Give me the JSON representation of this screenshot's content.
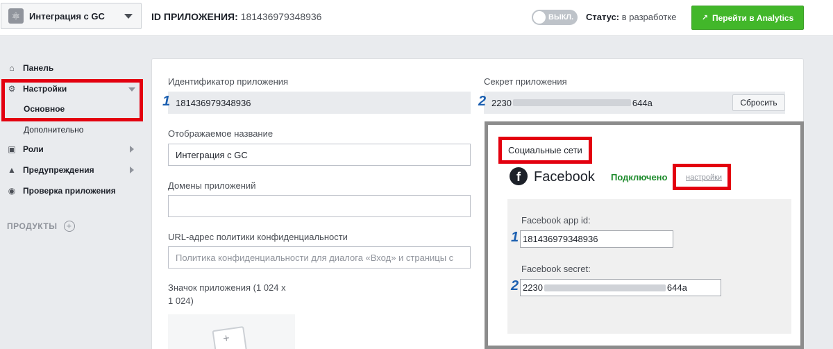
{
  "header": {
    "app_name": "Интеграция с GC",
    "app_id_label": "ID ПРИЛОЖЕНИЯ:",
    "app_id_value": "181436979348936",
    "toggle_label": "ВЫКЛ.",
    "status_label": "Статус:",
    "status_value": "в разработке",
    "analytics_button": "Перейти в Analytics"
  },
  "sidebar": {
    "items": [
      {
        "label": "Панель",
        "icon": "home-icon"
      },
      {
        "label": "Настройки",
        "icon": "gear-icon"
      },
      {
        "label": "Основное"
      },
      {
        "label": "Дополнительно"
      },
      {
        "label": "Роли",
        "icon": "roles-icon"
      },
      {
        "label": "Предупреждения",
        "icon": "bell-icon"
      },
      {
        "label": "Проверка приложения",
        "icon": "eye-icon"
      }
    ],
    "products_label": "ПРОДУКТЫ"
  },
  "form": {
    "app_id_label": "Идентификатор приложения",
    "app_id_value": "181436979348936",
    "secret_label": "Секрет приложения",
    "secret_prefix": "2230",
    "secret_suffix": "644a",
    "reset_button": "Сбросить",
    "display_name_label": "Отображаемое название",
    "display_name_value": "Интеграция с GC",
    "domains_label": "Домены приложений",
    "domains_value": "",
    "privacy_label": "URL-адрес политики конфиденциальности",
    "privacy_placeholder": "Политика конфиденциальности для диалога «Вход» и страницы с",
    "icon_label_line1": "Значок приложения (1 024 x",
    "icon_label_line2": "1 024)"
  },
  "social": {
    "title": "Социальные сети",
    "provider": "Facebook",
    "connected": "Подключено",
    "settings_link": "настройки",
    "fb_app_id_label": "Facebook app id:",
    "fb_app_id_value": "181436979348936",
    "fb_secret_label": "Facebook secret:",
    "fb_secret_prefix": "2230",
    "fb_secret_suffix": "644a"
  },
  "annotations": {
    "num1": "1",
    "num2": "2"
  },
  "colors": {
    "highlight": "#e3000f",
    "analytics_button": "#42b72a",
    "annotation_number": "#1b5fb0",
    "connected": "#1b8a2a"
  }
}
